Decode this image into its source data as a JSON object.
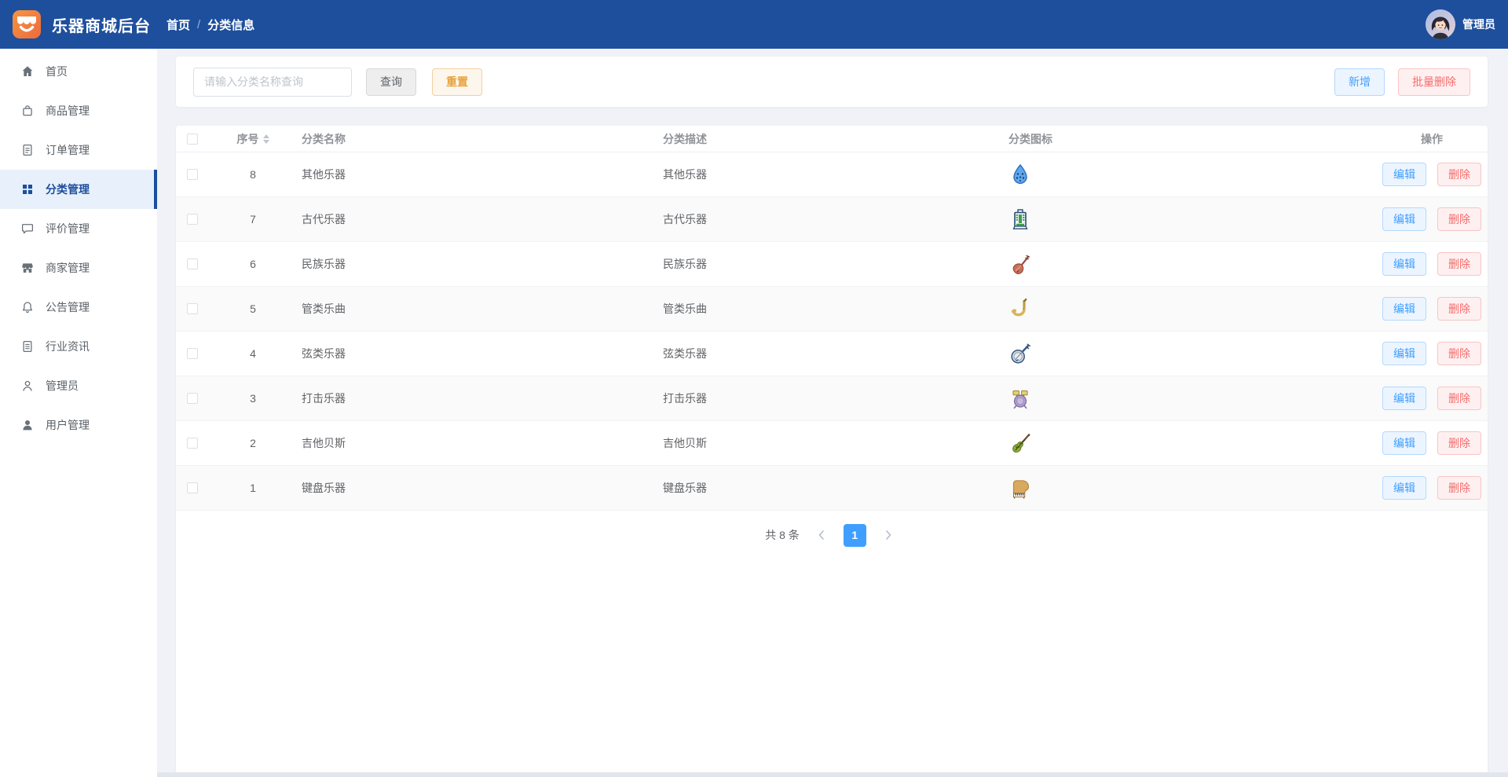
{
  "topbar": {
    "brand": "乐器商城后台",
    "breadcrumb": {
      "home": "首页",
      "separator": "/",
      "current": "分类信息"
    },
    "user": {
      "name": "管理员",
      "avatar": "anime-girl-avatar"
    }
  },
  "sidebar": {
    "items": [
      {
        "label": "首页",
        "icon": "home-icon",
        "active": false
      },
      {
        "label": "商品管理",
        "icon": "shopping-bag-icon",
        "active": false
      },
      {
        "label": "订单管理",
        "icon": "order-doc-icon",
        "active": false
      },
      {
        "label": "分类管理",
        "icon": "grid-icon",
        "active": true
      },
      {
        "label": "评价管理",
        "icon": "comment-icon",
        "active": false
      },
      {
        "label": "商家管理",
        "icon": "store-icon",
        "active": false
      },
      {
        "label": "公告管理",
        "icon": "bell-icon",
        "active": false
      },
      {
        "label": "行业资讯",
        "icon": "news-doc-icon",
        "active": false
      },
      {
        "label": "管理员",
        "icon": "admin-person-icon",
        "active": false
      },
      {
        "label": "用户管理",
        "icon": "user-person-icon",
        "active": false
      }
    ]
  },
  "toolbar": {
    "search_placeholder": "请输入分类名称查询",
    "search_value": "",
    "query_label": "查询",
    "reset_label": "重置",
    "add_label": "新增",
    "batch_delete_label": "批量删除"
  },
  "table": {
    "columns": [
      {
        "label": "序号",
        "sortable": true
      },
      {
        "label": "分类名称",
        "sortable": false
      },
      {
        "label": "分类描述",
        "sortable": false
      },
      {
        "label": "分类图标",
        "sortable": false
      },
      {
        "label": "操作",
        "sortable": false
      }
    ],
    "edit_label": "编辑",
    "delete_label": "删除",
    "rows": [
      {
        "id": "8",
        "name": "其他乐器",
        "description": "其他乐器",
        "icon": "ocarina-icon"
      },
      {
        "id": "7",
        "name": "古代乐器",
        "description": "古代乐器",
        "icon": "ancient-instrument-icon"
      },
      {
        "id": "6",
        "name": "民族乐器",
        "description": "民族乐器",
        "icon": "pipa-icon"
      },
      {
        "id": "5",
        "name": "管类乐曲",
        "description": "管类乐曲",
        "icon": "saxophone-icon"
      },
      {
        "id": "4",
        "name": "弦类乐器",
        "description": "弦类乐器",
        "icon": "banjo-icon"
      },
      {
        "id": "3",
        "name": "打击乐器",
        "description": "打击乐器",
        "icon": "drum-kit-icon"
      },
      {
        "id": "2",
        "name": "吉他贝斯",
        "description": "吉他贝斯",
        "icon": "violin-icon"
      },
      {
        "id": "1",
        "name": "键盘乐器",
        "description": "键盘乐器",
        "icon": "piano-icon"
      }
    ]
  },
  "pagination": {
    "total_label": "共 8 条",
    "current_page": "1"
  },
  "colors": {
    "topbar_blue": "#1e4f9d",
    "sidebar_active_bg": "#e8f1fb",
    "sidebar_active_text": "#1d4e9e",
    "accent_blue": "#409eff",
    "danger_red": "#f56c6c",
    "warning_orange": "#e6a23c",
    "stripe_gray": "#fafafa"
  }
}
